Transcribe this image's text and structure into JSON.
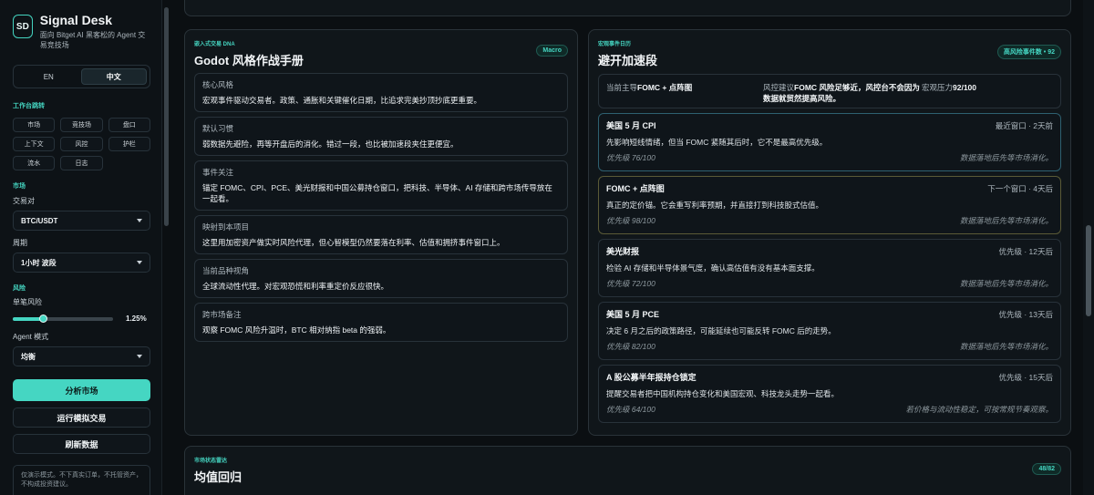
{
  "brand": {
    "logo": "SD",
    "title": "Signal Desk",
    "subtitle": "面向 Bitget AI 黑客松的 Agent 交易竞技场"
  },
  "lang": {
    "en": "EN",
    "zh": "中文",
    "active": "zh"
  },
  "sidebar": {
    "workspace_label": "工作台跳转",
    "chips": [
      "市场",
      "竞技场",
      "盘口",
      "上下文",
      "风控",
      "护栏",
      "流水",
      "日志"
    ],
    "market_label": "市场",
    "pair_label": "交易对",
    "pair_value": "BTC/USDT",
    "period_label": "周期",
    "period_value": "1小时 波段",
    "risk_label": "风险",
    "single_risk_label": "单笔风险",
    "single_risk_value": "1.25%",
    "single_risk_fraction": 0.3,
    "agent_mode_label": "Agent 模式",
    "agent_mode_value": "均衡",
    "analyze_button": "分析市场",
    "simulate_button": "运行模拟交易",
    "refresh_button": "刷新数据",
    "notice": "仅演示模式。不下真实订单，不托管资产，不构成投资建议。"
  },
  "dna": {
    "kicker": "嵌入式交易 DNA",
    "title": "Godot 风格作战手册",
    "badge": "Macro",
    "cards": [
      {
        "h": "核心风格",
        "b": "宏观事件驱动交易者。政策、通胀和关键催化日期，比追求完美抄顶抄底更重要。"
      },
      {
        "h": "默认习惯",
        "b": "弱数据先避险，再等开盘后的消化。错过一段，也比被加速段夹住更便宜。"
      },
      {
        "h": "事件关注",
        "b": "锚定 FOMC、CPI、PCE、美光财报和中国公募持仓窗口，把科技、半导体、AI 存储和跨市场传导放在一起看。"
      },
      {
        "h": "映射到本项目",
        "b": "这里用加密资产做实时风险代理，但心智模型仍然要落在利率、估值和拥挤事件窗口上。"
      },
      {
        "h": "当前品种视角",
        "b": "全球流动性代理。对宏观恐慌和利率重定价反应很快。"
      },
      {
        "h": "跨市场备注",
        "b": "观察 FOMC 风险升温时，BTC 相对纳指 beta 的强弱。"
      }
    ]
  },
  "events": {
    "kicker": "宏观事件日历",
    "title": "避开加速段",
    "badge": "高风险事件数 • 92",
    "focus": {
      "main_label": "当前主导",
      "main_value": "FOMC + 点阵图",
      "advice_label": "风控建议",
      "advice_value": "FOMC 风险足够近，风控台不会因为数据就贸然提高风险。",
      "pressure_label": "宏观压力",
      "pressure_value": "92/100"
    },
    "items": [
      {
        "title": "美国 5 月 CPI",
        "meta": "最近窗口 · 2天前",
        "desc": "先影响短线情绪，但当 FOMC 紧随其后时，它不是最高优先级。",
        "pri": "优先级 76/100",
        "note": "数据落地后先等市场消化。"
      },
      {
        "title": "FOMC + 点阵图",
        "meta": "下一个窗口 · 4天后",
        "desc": "真正的定价锚。它会重写利率预期，并直接打到科技股式估值。",
        "pri": "优先级 98/100",
        "note": "数据落地后先等市场消化。"
      },
      {
        "title": "美光财报",
        "meta": "优先级 · 12天后",
        "desc": "检验 AI 存储和半导体景气度，确认高估值有没有基本面支撑。",
        "pri": "优先级 72/100",
        "note": "数据落地后先等市场消化。"
      },
      {
        "title": "美国 5 月 PCE",
        "meta": "优先级 · 13天后",
        "desc": "决定 6 月之后的政策路径，可能延续也可能反转 FOMC 后的走势。",
        "pri": "优先级 82/100",
        "note": "数据落地后先等市场消化。"
      },
      {
        "title": "A 股公募半年报持仓锁定",
        "meta": "优先级 · 15天后",
        "desc": "提醒交易者把中国机构持仓变化和美国宏观、科技龙头走势一起看。",
        "pri": "优先级 64/100",
        "note": "若价格与流动性稳定，可按常规节奏观察。"
      }
    ]
  },
  "regime": {
    "kicker": "市场状态雷达",
    "title": "均值回归",
    "badge": "48/82"
  }
}
